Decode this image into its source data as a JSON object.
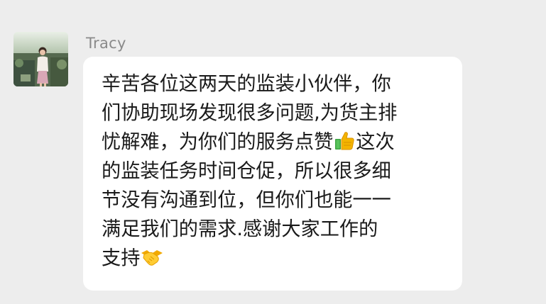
{
  "message": {
    "sender": "Tracy",
    "lines": {
      "l1": "辛苦各位这两天的监装小伙伴，你",
      "l2": "们协助现场发现很多问题,为货主排",
      "l3a": "忧解难，为你们的服务点赞",
      "l3b": "这次",
      "l4": "的监装任务时间仓促，所以很多细",
      "l5": "节没有沟通到位，但你们也能一一",
      "l6": "满足我们的需求.感谢大家工作的",
      "l7": "支持"
    },
    "emojis": {
      "thumbs": "thumbs-up-icon",
      "handshake": "handshake-icon"
    }
  }
}
